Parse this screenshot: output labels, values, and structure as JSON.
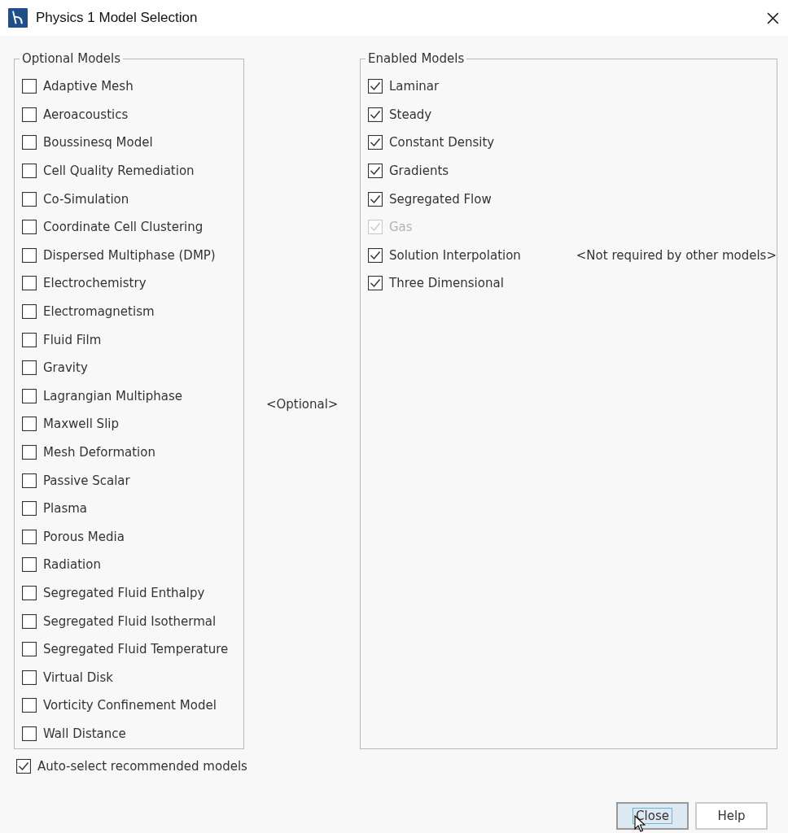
{
  "window": {
    "title": "Physics 1 Model Selection"
  },
  "optional_models": {
    "title": "Optional Models",
    "items": [
      {
        "label": "Adaptive Mesh",
        "checked": false
      },
      {
        "label": "Aeroacoustics",
        "checked": false
      },
      {
        "label": "Boussinesq Model",
        "checked": false
      },
      {
        "label": "Cell Quality Remediation",
        "checked": false
      },
      {
        "label": "Co-Simulation",
        "checked": false
      },
      {
        "label": "Coordinate Cell Clustering",
        "checked": false
      },
      {
        "label": "Dispersed Multiphase (DMP)",
        "checked": false
      },
      {
        "label": "Electrochemistry",
        "checked": false
      },
      {
        "label": "Electromagnetism",
        "checked": false
      },
      {
        "label": "Fluid Film",
        "checked": false
      },
      {
        "label": "Gravity",
        "checked": false
      },
      {
        "label": "Lagrangian Multiphase",
        "checked": false
      },
      {
        "label": "Maxwell Slip",
        "checked": false
      },
      {
        "label": "Mesh Deformation",
        "checked": false
      },
      {
        "label": "Passive Scalar",
        "checked": false
      },
      {
        "label": "Plasma",
        "checked": false
      },
      {
        "label": "Porous Media",
        "checked": false
      },
      {
        "label": "Radiation",
        "checked": false
      },
      {
        "label": "Segregated Fluid Enthalpy",
        "checked": false
      },
      {
        "label": "Segregated Fluid Isothermal",
        "checked": false
      },
      {
        "label": "Segregated Fluid Temperature",
        "checked": false
      },
      {
        "label": "Virtual Disk",
        "checked": false
      },
      {
        "label": "Vorticity Confinement Model",
        "checked": false
      },
      {
        "label": "Wall Distance",
        "checked": false
      }
    ]
  },
  "optional_description": "<Optional>",
  "enabled_models": {
    "title": "Enabled Models",
    "items": [
      {
        "label": "Laminar",
        "checked": true,
        "disabled": false
      },
      {
        "label": "Steady",
        "checked": true,
        "disabled": false
      },
      {
        "label": "Constant Density",
        "checked": true,
        "disabled": false
      },
      {
        "label": "Gradients",
        "checked": true,
        "disabled": false
      },
      {
        "label": "Segregated Flow",
        "checked": true,
        "disabled": false
      },
      {
        "label": "Gas",
        "checked": true,
        "disabled": true
      },
      {
        "label": "Solution Interpolation",
        "checked": true,
        "disabled": false,
        "note": "<Not required by other models>"
      },
      {
        "label": "Three Dimensional",
        "checked": true,
        "disabled": false
      }
    ]
  },
  "auto_select": {
    "label": "Auto-select recommended models",
    "checked": true
  },
  "buttons": [
    {
      "label": "Close",
      "focused": true
    },
    {
      "label": "Help",
      "focused": false
    }
  ]
}
